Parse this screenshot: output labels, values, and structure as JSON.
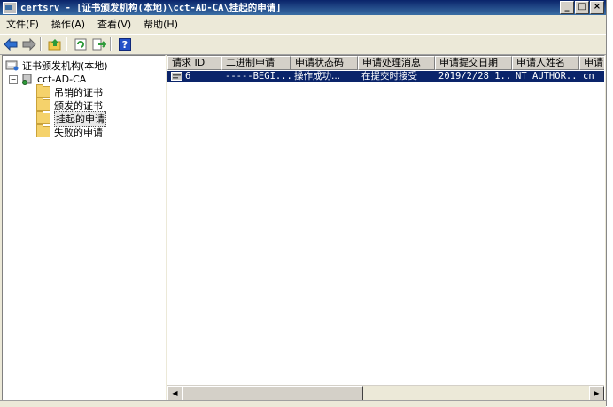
{
  "window": {
    "title": "certsrv - [证书颁发机构(本地)\\cct-AD-CA\\挂起的申请]"
  },
  "menu": [
    "文件(F)",
    "操作(A)",
    "查看(V)",
    "帮助(H)"
  ],
  "toolbar": {
    "icons": [
      "back-arrow-icon",
      "forward-arrow-icon",
      "up-folder-icon",
      "refresh-icon",
      "export-list-icon",
      "help-icon"
    ]
  },
  "tree": {
    "root": "证书颁发机构(本地)",
    "ca": "cct-AD-CA",
    "folders": [
      "吊销的证书",
      "颁发的证书",
      "挂起的申请",
      "失败的申请"
    ],
    "selected": "挂起的申请"
  },
  "list": {
    "columns": [
      "请求 ID",
      "二进制申请",
      "申请状态码",
      "申请处理消息",
      "申请提交日期",
      "申请人姓名",
      "申请"
    ],
    "rows": [
      {
        "id": "6",
        "binary": "-----BEGI...",
        "status": "操作成功...",
        "message": "在提交时接受",
        "date": "2019/2/28 1...",
        "requester": "NT AUTHOR...",
        "extra": "cn"
      }
    ]
  },
  "colors": {
    "titlebar": "#0a246a",
    "selection": "#0a246a",
    "chrome": "#ece9d8"
  }
}
